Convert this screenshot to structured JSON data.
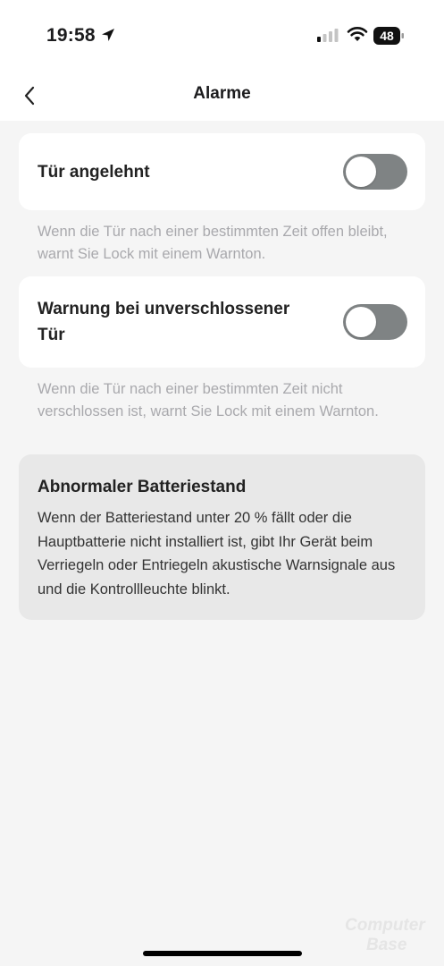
{
  "status_bar": {
    "time": "19:58",
    "battery_level": "48",
    "icons": [
      "location-arrow-icon",
      "signal-icon",
      "wifi-icon",
      "battery-icon"
    ]
  },
  "nav": {
    "title": "Alarme",
    "back_icon": "chevron-left-icon"
  },
  "settings": [
    {
      "label": "Tür angelehnt",
      "enabled": false,
      "description": "Wenn die Tür nach einer bestimmten Zeit offen bleibt, warnt Sie Lock mit einem Warnton."
    },
    {
      "label_line1": "Warnung bei unverschlossener",
      "label_line2": "Tür",
      "enabled": false,
      "description": "Wenn die Tür nach einer bestimmten Zeit nicht verschlossen ist, warnt Sie Lock mit einem Warnton."
    }
  ],
  "info": {
    "title": "Abnormaler Batteriestand",
    "body": "Wenn der Batteriestand unter 20 % fällt oder die Hauptbatterie nicht installiert ist, gibt Ihr Gerät beim Verriegeln oder Entriegeln akustische Warnsignale aus und die Kontrollleuchte blinkt."
  },
  "watermark": {
    "line1": "Computer",
    "line2": "Base"
  },
  "colors": {
    "background": "#f5f5f5",
    "card": "#ffffff",
    "toggle_off": "#7f8384",
    "info_box": "#e8e8e8",
    "description_text": "#a9a9ad"
  }
}
